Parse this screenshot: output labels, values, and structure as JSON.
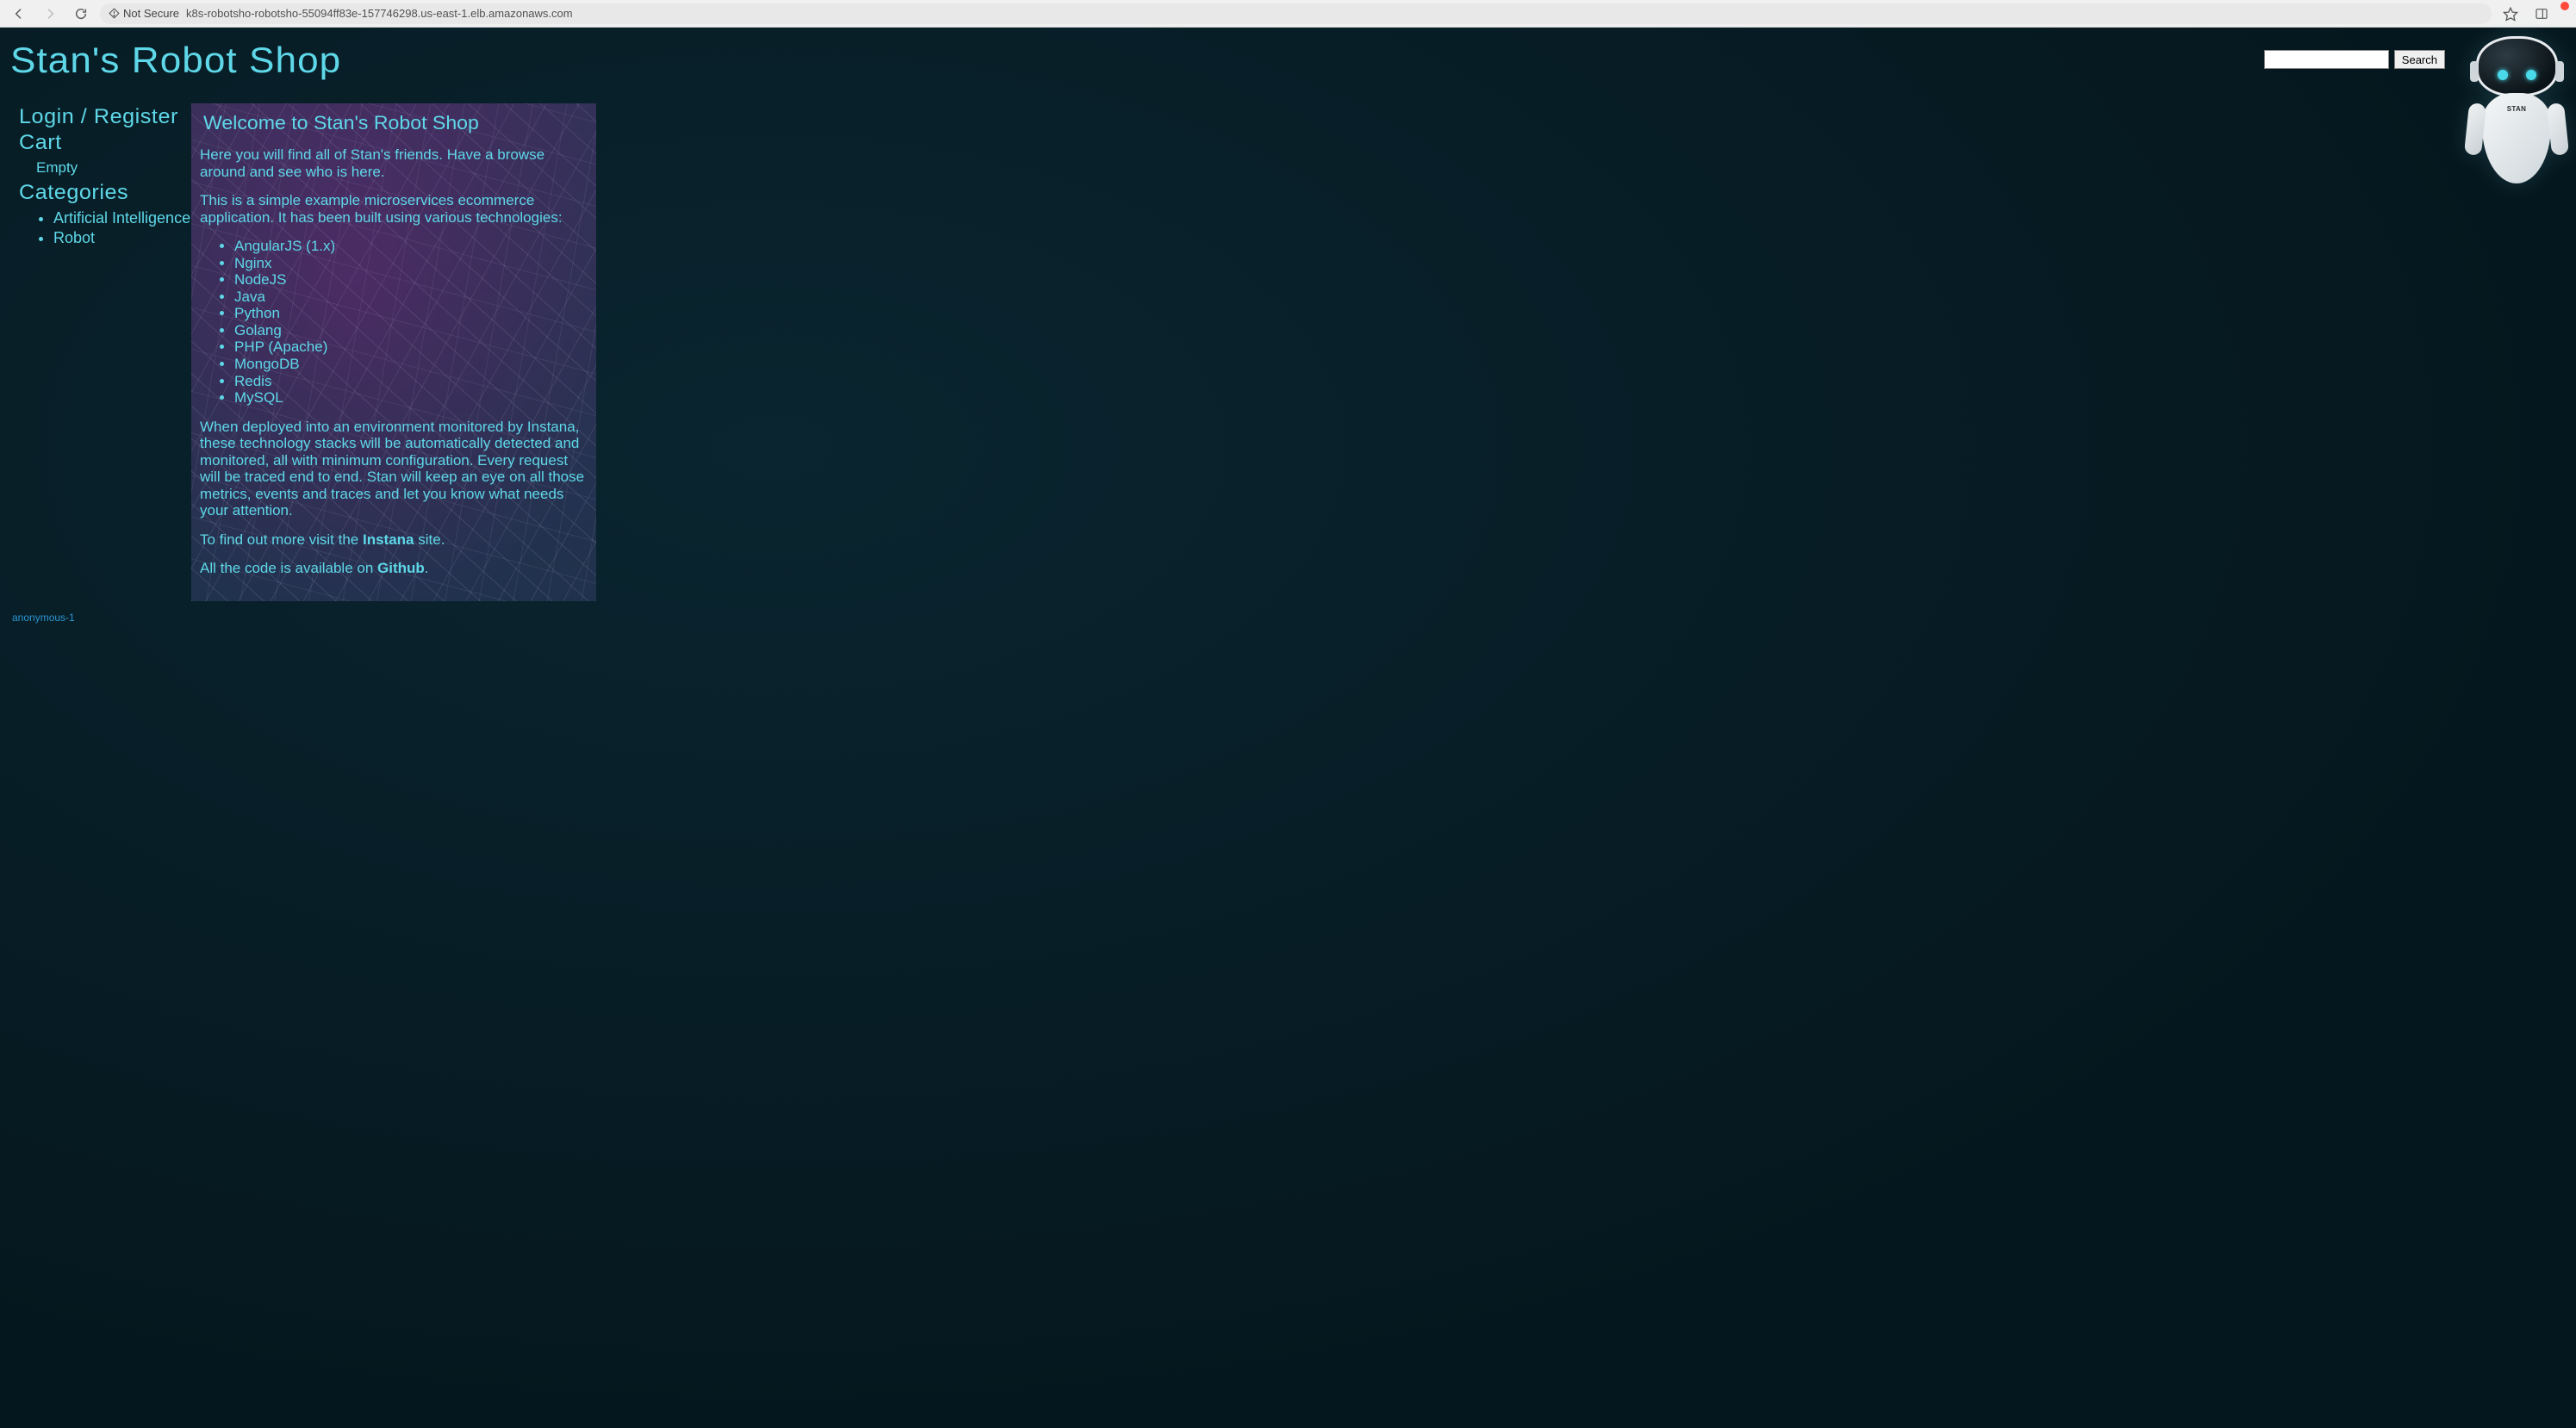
{
  "browser": {
    "security_label": "Not Secure",
    "url": "k8s-robotsho-robotsho-55094ff83e-157746298.us-east-1.elb.amazonaws.com"
  },
  "header": {
    "site_title": "Stan's Robot Shop",
    "search_button": "Search",
    "mascot_label": "STAN"
  },
  "sidebar": {
    "login_register": "Login / Register",
    "cart": "Cart",
    "cart_status": "Empty",
    "categories_heading": "Categories",
    "categories": [
      "Artificial Intelligence",
      "Robot"
    ]
  },
  "main": {
    "title": "Welcome to Stan's Robot Shop",
    "intro": "Here you will find all of Stan's friends. Have a browse around and see who is here.",
    "desc": "This is a simple example microservices ecommerce application. It has been built using various technologies:",
    "tech": [
      "AngularJS (1.x)",
      "Nginx",
      "NodeJS",
      "Java",
      "Python",
      "Golang",
      "PHP (Apache)",
      "MongoDB",
      "Redis",
      "MySQL"
    ],
    "monitor": "When deployed into an environment monitored by Instana, these technology stacks will be automatically detected and monitored, all with minimum configuration. Every request will be traced end to end. Stan will keep an eye on all those metrics, events and traces and let you know what needs your attention.",
    "more_pre": "To find out more visit the ",
    "more_link": "Instana",
    "more_post": " site.",
    "code_pre": "All the code is available on ",
    "code_link": "Github",
    "code_post": "."
  },
  "footer": {
    "user_id": "anonymous-1"
  }
}
